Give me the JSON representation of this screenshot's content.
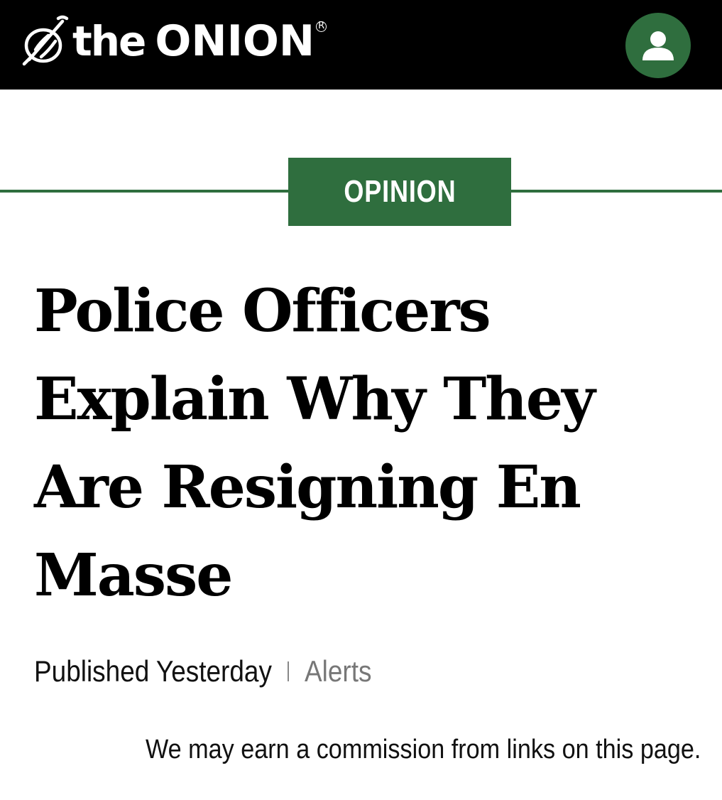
{
  "header": {
    "logo_the": "the",
    "logo_brand": "ONION",
    "logo_reg": "R",
    "account_icon": "user-icon"
  },
  "article": {
    "section_tag": "OPINION",
    "headline": "Police Officers Explain Why They Are Resigning En Masse",
    "published": "Published Yesterday",
    "alerts_label": "Alerts",
    "disclaimer": "We may earn a commission from links on this page."
  },
  "colors": {
    "brand_green": "#2f6e3e",
    "header_bg": "#000000",
    "meta_grey": "#777777"
  }
}
